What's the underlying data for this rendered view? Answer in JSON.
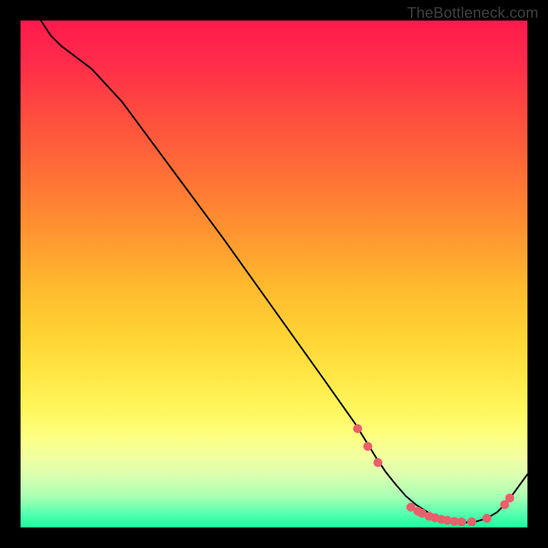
{
  "watermark": "TheBottleneck.com",
  "chart_data": {
    "type": "line",
    "title": "",
    "xlabel": "",
    "ylabel": "",
    "xlim": [
      0,
      100
    ],
    "ylim": [
      0,
      100
    ],
    "grid": false,
    "series": [
      {
        "name": "curve",
        "x": [
          4,
          6,
          8,
          10,
          14,
          20,
          30,
          40,
          50,
          60,
          66,
          70,
          72,
          74,
          76,
          78,
          80,
          82,
          84,
          86,
          88,
          90,
          92,
          94,
          96,
          100
        ],
        "y": [
          100,
          97,
          95,
          93.5,
          90.5,
          84,
          70.5,
          57,
          43,
          29,
          20.5,
          14,
          11,
          8.5,
          6.2,
          4.5,
          3.2,
          2.2,
          1.5,
          1.1,
          1.0,
          1.2,
          1.8,
          3.0,
          5.0,
          10.5
        ]
      }
    ],
    "markers": [
      {
        "x": 66.5,
        "y": 19.5
      },
      {
        "x": 68.5,
        "y": 16.0
      },
      {
        "x": 70.5,
        "y": 12.8
      },
      {
        "x": 77.0,
        "y": 4.0
      },
      {
        "x": 78.4,
        "y": 3.2
      },
      {
        "x": 79.2,
        "y": 2.8
      },
      {
        "x": 80.6,
        "y": 2.2
      },
      {
        "x": 81.8,
        "y": 1.9
      },
      {
        "x": 83.0,
        "y": 1.6
      },
      {
        "x": 84.2,
        "y": 1.4
      },
      {
        "x": 85.6,
        "y": 1.2
      },
      {
        "x": 87.0,
        "y": 1.1
      },
      {
        "x": 89.0,
        "y": 1.1
      },
      {
        "x": 92.0,
        "y": 1.8
      },
      {
        "x": 95.5,
        "y": 4.5
      },
      {
        "x": 96.5,
        "y": 5.8
      }
    ],
    "gradient_stops": [
      {
        "pos": 0,
        "color": "#ff1a4d"
      },
      {
        "pos": 50,
        "color": "#ffb82e"
      },
      {
        "pos": 80,
        "color": "#fdff80"
      },
      {
        "pos": 100,
        "color": "#18ff9e"
      }
    ]
  }
}
